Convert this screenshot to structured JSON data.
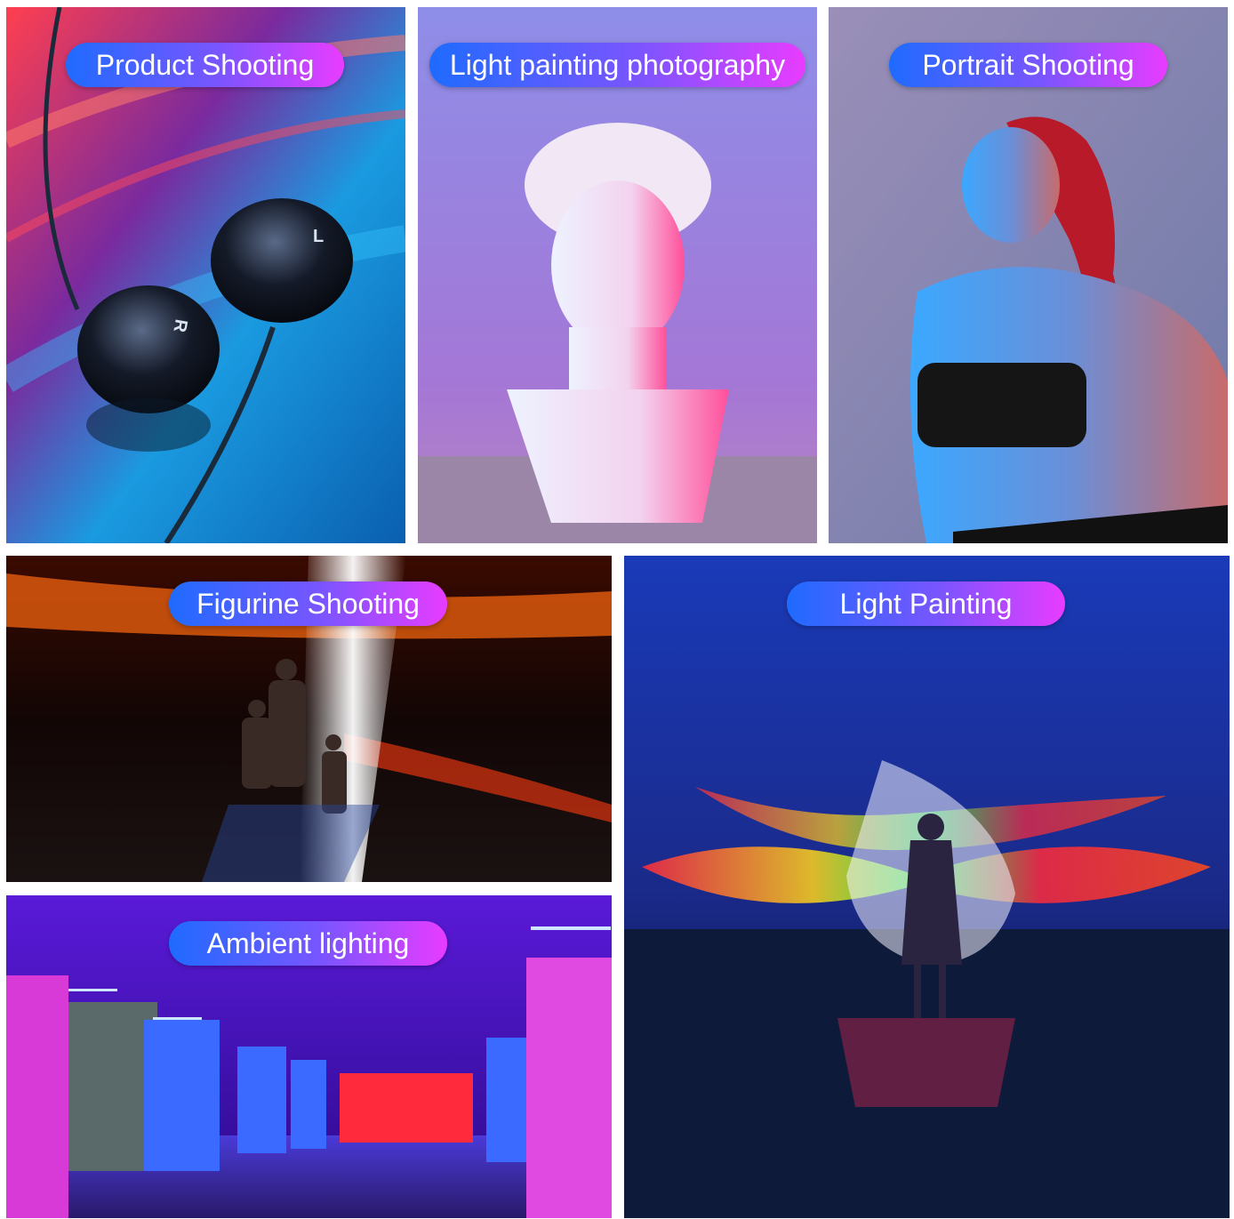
{
  "panels": {
    "product": {
      "label": "Product Shooting"
    },
    "light_photo": {
      "label": "Light painting photography"
    },
    "portrait": {
      "label": "Portrait Shooting"
    },
    "figurine": {
      "label": "Figurine Shooting"
    },
    "ambient": {
      "label": "Ambient lighting"
    },
    "light_painting": {
      "label": "Light Painting"
    }
  },
  "earbud_marks": {
    "left": "L",
    "right": "R"
  },
  "colors": {
    "pill_start": "#1f6bff",
    "pill_end": "#e83cff",
    "accent_red": "#ff2a3c",
    "accent_blue": "#1fa9ff",
    "accent_magenta": "#ff2fd4"
  }
}
